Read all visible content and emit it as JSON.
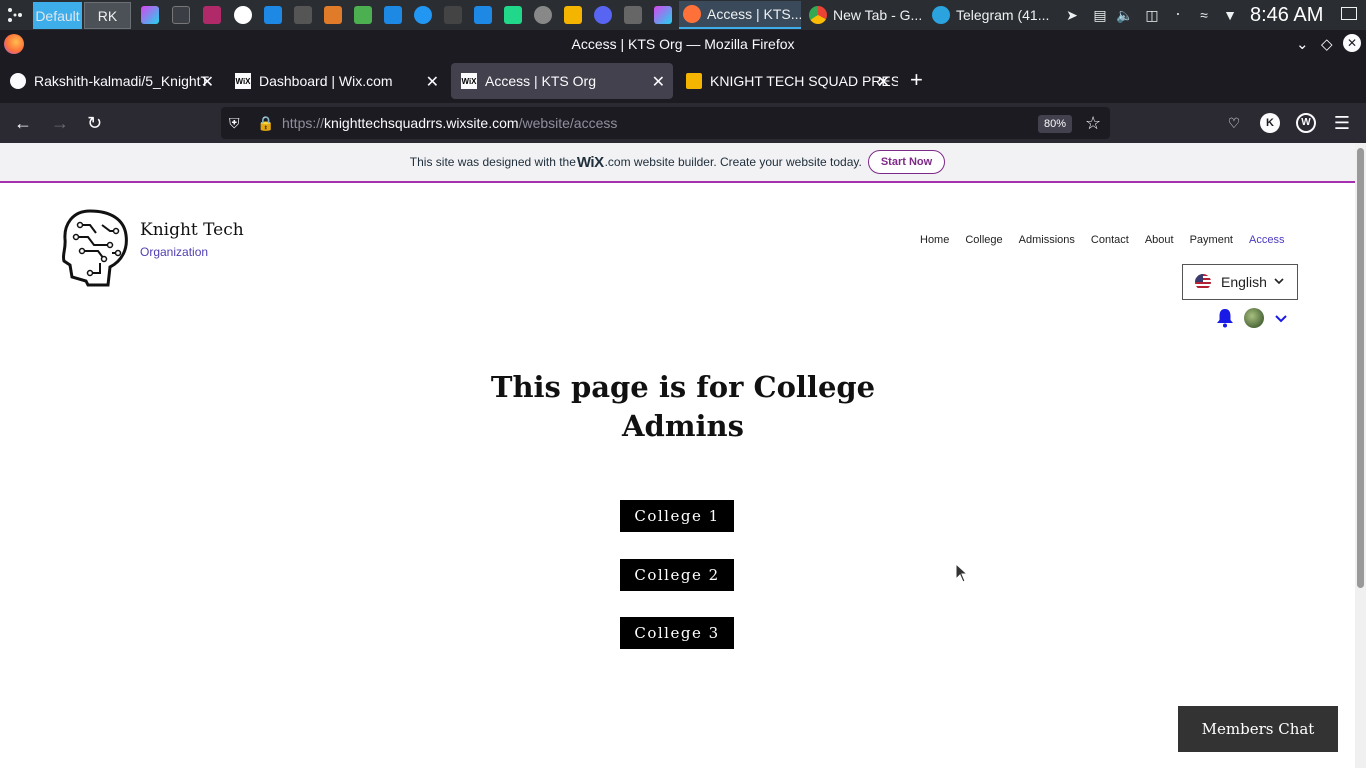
{
  "taskbar": {
    "workspaces": [
      "Default",
      "RK"
    ],
    "tasks": [
      {
        "label": "Access | KTS...",
        "color": "#ff7139",
        "active": true
      },
      {
        "label": "New Tab - G...",
        "color": "#4285f4",
        "active": false
      },
      {
        "label": "Telegram (41...",
        "color": "#2aa3df",
        "active": false
      }
    ],
    "clock": "8:46 AM"
  },
  "window": {
    "title": "Access | KTS Org — Mozilla Firefox"
  },
  "tabs": [
    {
      "label": "Rakshith-kalmadi/5_KnightT",
      "favicon": "github-icon"
    },
    {
      "label": "Dashboard | Wix.com",
      "favicon": "wix-icon"
    },
    {
      "label": "Access | KTS Org",
      "favicon": "wix-icon",
      "active": true
    },
    {
      "label": "KNIGHT TECH SQUAD PRES",
      "favicon": "slides-icon"
    }
  ],
  "urlbar": {
    "scheme": "https://",
    "host": "knighttechsquadrrs.wixsite.com",
    "path": "/website/access",
    "zoom": "80%"
  },
  "wix_banner": {
    "text_before": "This site was designed with the",
    "wix_word": "WiX",
    "text_after": ".com website builder. Create your website today.",
    "cta": "Start Now"
  },
  "site": {
    "brand_name": "Knight Tech",
    "brand_sub": "Organization",
    "nav": [
      "Home",
      "College",
      "Admissions",
      "Contact",
      "About",
      "Payment",
      "Access"
    ],
    "nav_current": "Access",
    "language": "English",
    "heading_line1": "This page is for College",
    "heading_line2": "Admins",
    "buttons": [
      "College 1",
      "College 2",
      "College 3"
    ],
    "members_chat": "Members Chat"
  }
}
